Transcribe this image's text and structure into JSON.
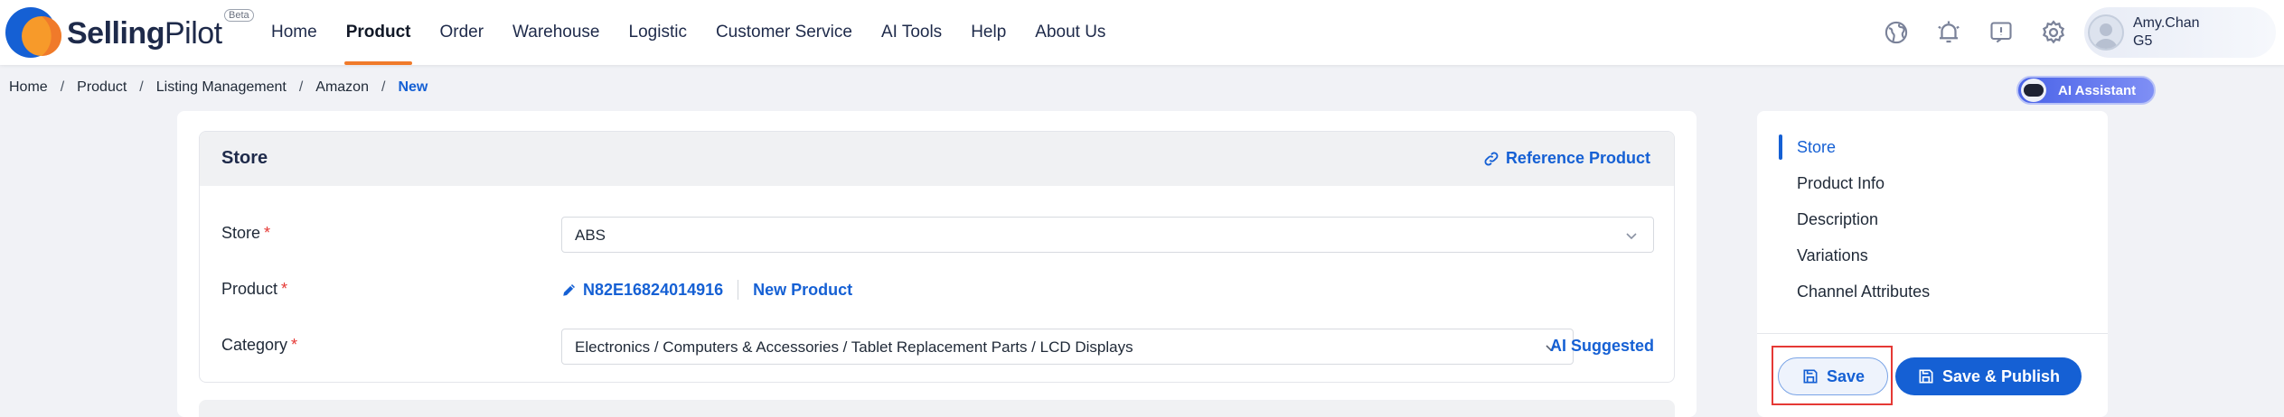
{
  "app": {
    "brand_bold": "Selling",
    "brand_light": "Pilot",
    "beta_label": "Beta"
  },
  "nav": {
    "items": [
      {
        "label": "Home",
        "active": false
      },
      {
        "label": "Product",
        "active": true
      },
      {
        "label": "Order",
        "active": false
      },
      {
        "label": "Warehouse",
        "active": false
      },
      {
        "label": "Logistic",
        "active": false
      },
      {
        "label": "Customer Service",
        "active": false
      },
      {
        "label": "AI Tools",
        "active": false
      },
      {
        "label": "Help",
        "active": false
      },
      {
        "label": "About Us",
        "active": false
      }
    ],
    "accent_color": "#f07a2a"
  },
  "header_icons": [
    "globe-icon",
    "bell-icon",
    "feedback-icon",
    "settings-icon"
  ],
  "user": {
    "name": "Amy.Chan",
    "org": "G5"
  },
  "breadcrumb": {
    "items": [
      "Home",
      "Product",
      "Listing Management",
      "Amazon"
    ],
    "current": "New"
  },
  "ai_assistant": {
    "label": "AI Assistant"
  },
  "store_section": {
    "title": "Store",
    "reference_link": "Reference Product",
    "store": {
      "label": "Store",
      "value": "ABS"
    },
    "product": {
      "label": "Product",
      "id": "N82E16824014916",
      "status": "New Product"
    },
    "category": {
      "label": "Category",
      "value": "Electronics / Computers & Accessories / Tablet Replacement Parts / LCD Displays",
      "ai_suggested": "AI Suggested"
    },
    "required_mark": "*"
  },
  "side_nav": {
    "items": [
      {
        "label": "Store",
        "active": true
      },
      {
        "label": "Product Info",
        "active": false
      },
      {
        "label": "Description",
        "active": false
      },
      {
        "label": "Variations",
        "active": false
      },
      {
        "label": "Channel Attributes",
        "active": false
      }
    ]
  },
  "actions": {
    "save_label": "Save",
    "save_publish_label": "Save & Publish"
  },
  "colors": {
    "primary": "#1560d4",
    "required": "#e53935",
    "highlight": "#e53935"
  }
}
